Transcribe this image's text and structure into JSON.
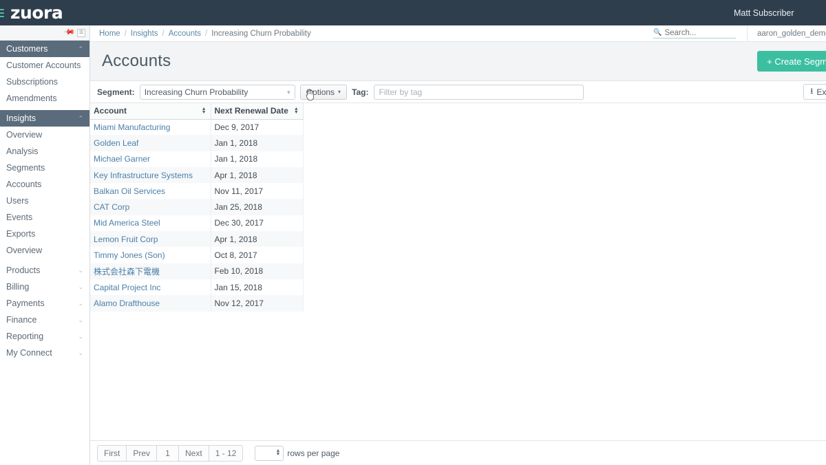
{
  "topbar": {
    "menu_icon": "hamburger-icon",
    "logo": "zuora",
    "user": "Matt Subscriber"
  },
  "sidebar": {
    "pin_icon": "pin-icon",
    "collapse_icon": "collapse-icon",
    "groups": [
      {
        "label": "Customers",
        "expanded": true,
        "chevron": "⌃",
        "items": [
          {
            "label": "Customer Accounts"
          },
          {
            "label": "Subscriptions"
          },
          {
            "label": "Amendments"
          }
        ]
      },
      {
        "label": "Insights",
        "expanded": true,
        "chevron": "⌃",
        "items": [
          {
            "label": "Overview"
          },
          {
            "label": "Analysis"
          },
          {
            "label": "Segments"
          },
          {
            "label": "Accounts"
          },
          {
            "label": "Users"
          },
          {
            "label": "Events"
          },
          {
            "label": "Exports"
          },
          {
            "label": "Overview"
          }
        ]
      }
    ],
    "collapsed_items": [
      {
        "label": "Products",
        "chevron": "⌄"
      },
      {
        "label": "Billing",
        "chevron": "⌄"
      },
      {
        "label": "Payments",
        "chevron": "⌄"
      },
      {
        "label": "Finance",
        "chevron": "⌄"
      },
      {
        "label": "Reporting",
        "chevron": "⌄"
      },
      {
        "label": "My Connect",
        "chevron": "⌄"
      }
    ]
  },
  "breadcrumb": {
    "items": [
      "Home",
      "Insights",
      "Accounts"
    ],
    "current": "Increasing Churn Probability",
    "separator": "/"
  },
  "search": {
    "icon": "search-icon",
    "placeholder": "Search...",
    "value": ""
  },
  "account_switcher": {
    "value": "aaron_golden_demo"
  },
  "page": {
    "title": "Accounts",
    "create_segment_label": "+ Create Segment"
  },
  "filters": {
    "segment_label": "Segment:",
    "segment_value": "Increasing Churn Probability",
    "segment_options": [
      "Increasing Churn Probability"
    ],
    "options_label": "Options",
    "options_caret": "▾",
    "tag_label": "Tag:",
    "tag_placeholder": "Filter by tag",
    "tag_value": "",
    "export_label": "Export",
    "export_icon": "download-icon"
  },
  "table": {
    "columns": [
      {
        "label": "Account",
        "sortable": true
      },
      {
        "label": "Next Renewal Date",
        "sortable": true
      }
    ],
    "rows": [
      {
        "account": "Miami Manufacturing",
        "date": "Dec 9, 2017"
      },
      {
        "account": "Golden Leaf",
        "date": "Jan 1, 2018"
      },
      {
        "account": "Michael Garner",
        "date": "Jan 1, 2018"
      },
      {
        "account": "Key Infrastructure Systems",
        "date": "Apr 1, 2018"
      },
      {
        "account": "Balkan Oil Services",
        "date": "Nov 11, 2017"
      },
      {
        "account": "CAT Corp",
        "date": "Jan 25, 2018"
      },
      {
        "account": "Mid America Steel",
        "date": "Dec 30, 2017"
      },
      {
        "account": "Lemon Fruit Corp",
        "date": "Apr 1, 2018"
      },
      {
        "account": "Timmy Jones (Son)",
        "date": "Oct 8, 2017"
      },
      {
        "account": "株式会社森下電機",
        "date": "Feb 10, 2018"
      },
      {
        "account": "Capital Project Inc",
        "date": "Jan 15, 2018"
      },
      {
        "account": "Alamo Drafthouse",
        "date": "Nov 12, 2017"
      }
    ]
  },
  "pagination": {
    "first": "First",
    "prev": "Prev",
    "page": "1",
    "next": "Next",
    "range": "1 - 12",
    "rows_per_page_value": "",
    "rows_per_page_label": "rows per page"
  },
  "colors": {
    "topbar": "#2f3e4d",
    "accent_green": "#3cbfa0",
    "nav_group": "#5a6b7b",
    "link_blue": "#4a7fa8"
  }
}
